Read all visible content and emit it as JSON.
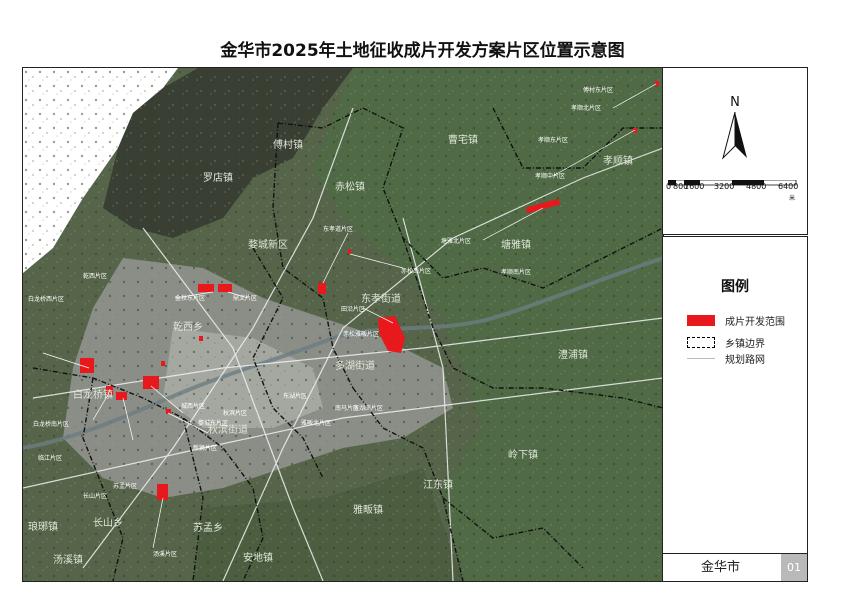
{
  "title": "金华市2025年土地征收成片开发方案片区位置示意图",
  "north": "N",
  "scale": {
    "ticks": [
      "0",
      "800",
      "1600",
      "3200",
      "4800",
      "6400"
    ],
    "unit": "米"
  },
  "legend": {
    "title": "图例",
    "items": [
      {
        "label": "成片开发范围",
        "kind": "fill",
        "color": "#e8191c"
      },
      {
        "label": "乡镇边界",
        "kind": "dashed-box",
        "color": "#000000"
      },
      {
        "label": "规划路网",
        "kind": "line",
        "color": "#ffffff"
      }
    ]
  },
  "footer": {
    "city": "金华市",
    "code": "01"
  },
  "map": {
    "towns": [
      "罗店镇",
      "赤松镇",
      "曹宅镇",
      "孝顺镇",
      "塘雅镇",
      "东孝街道",
      "多湖街道",
      "澧浦镇",
      "岭下镇",
      "江东镇",
      "雅畈镇",
      "秋滨街道",
      "白龙桥镇",
      "长山乡",
      "苏孟乡",
      "安地镇",
      "琅琊镇",
      "汤溪镇",
      "傅村镇",
      "婺城新区",
      "乾西乡"
    ],
    "parcels": [
      "金秋东片区",
      "鼎文片区",
      "东孝道片区",
      "赤松南片区",
      "田沿片区",
      "赤松雅畈片区",
      "南马片区",
      "秋滨片区",
      "城西片区",
      "婺城东片区",
      "东湖片区",
      "塘雅北片区",
      "孝顺南片区",
      "孝顺中片区",
      "孝顺东片区",
      "孝顺北片区",
      "傅村东片区",
      "多湖南片区",
      "雅畈北片区",
      "苏孟片区",
      "长山片区",
      "汤溪片区",
      "白龙桥西片区",
      "白龙桥南片区",
      "临江片区",
      "新狮片区",
      "乾西片区"
    ]
  }
}
